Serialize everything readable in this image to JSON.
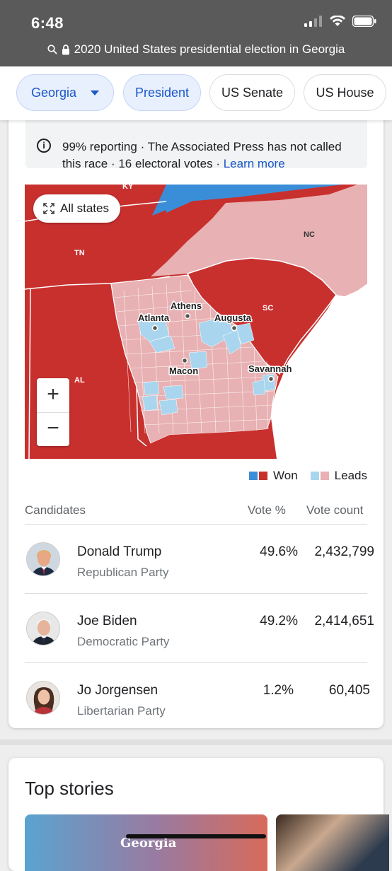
{
  "status_bar": {
    "time": "6:48"
  },
  "url_bar": {
    "url_text": "2020 United States presidential election in Georgia"
  },
  "chips": [
    {
      "label": "Georgia",
      "active": true,
      "has_dropdown": true
    },
    {
      "label": "President",
      "active": true
    },
    {
      "label": "US Senate",
      "active": false
    },
    {
      "label": "US House",
      "active": false
    }
  ],
  "notice": {
    "text": "99% reporting · The Associated Press has not called this race · 16 electoral votes · ",
    "link": "Learn more"
  },
  "map": {
    "all_states_label": "All states",
    "state_labels": {
      "ky": "KY",
      "tn": "TN",
      "nc": "NC",
      "sc": "SC",
      "al": "AL"
    },
    "cities": {
      "atlanta": "Atlanta",
      "athens": "Athens",
      "augusta": "Augusta",
      "macon": "Macon",
      "savannah": "Savannah"
    },
    "zoom_in": "+",
    "zoom_out": "−",
    "colors": {
      "dem_won": "#3a8ed8",
      "rep_won": "#c8302e",
      "dem_leads": "#a9d6ee",
      "rep_leads": "#e8b1b3"
    }
  },
  "legend": {
    "won": "Won",
    "leads": "Leads"
  },
  "table": {
    "headers": {
      "candidates": "Candidates",
      "vote_pct": "Vote %",
      "vote_count": "Vote count"
    },
    "rows": [
      {
        "name": "Donald Trump",
        "party": "Republican Party",
        "pct": "49.6%",
        "count": "2,432,799"
      },
      {
        "name": "Joe Biden",
        "party": "Democratic Party",
        "pct": "49.2%",
        "count": "2,414,651"
      },
      {
        "name": "Jo Jorgensen",
        "party": "Libertarian Party",
        "pct": "1.2%",
        "count": "60,405"
      }
    ]
  },
  "top_stories": {
    "title": "Top stories",
    "story1_overlay": "Georgia"
  }
}
